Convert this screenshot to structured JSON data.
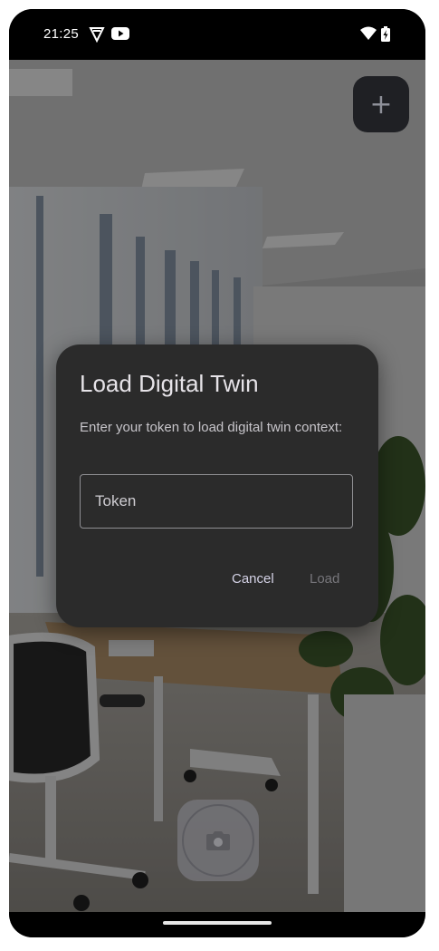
{
  "status_bar": {
    "time": "21:25"
  },
  "camera": {
    "add_icon": "plus-icon",
    "capture_icon": "camera-icon"
  },
  "dialog": {
    "title": "Load Digital Twin",
    "message": "Enter your token to load digital twin context:",
    "token_field": {
      "placeholder": "Token",
      "value": ""
    },
    "cancel_label": "Cancel",
    "load_label": "Load",
    "colors": {
      "surface": "#2b2b2b",
      "cancel": "#d4d2e6",
      "load_disabled": "#77767b"
    }
  }
}
